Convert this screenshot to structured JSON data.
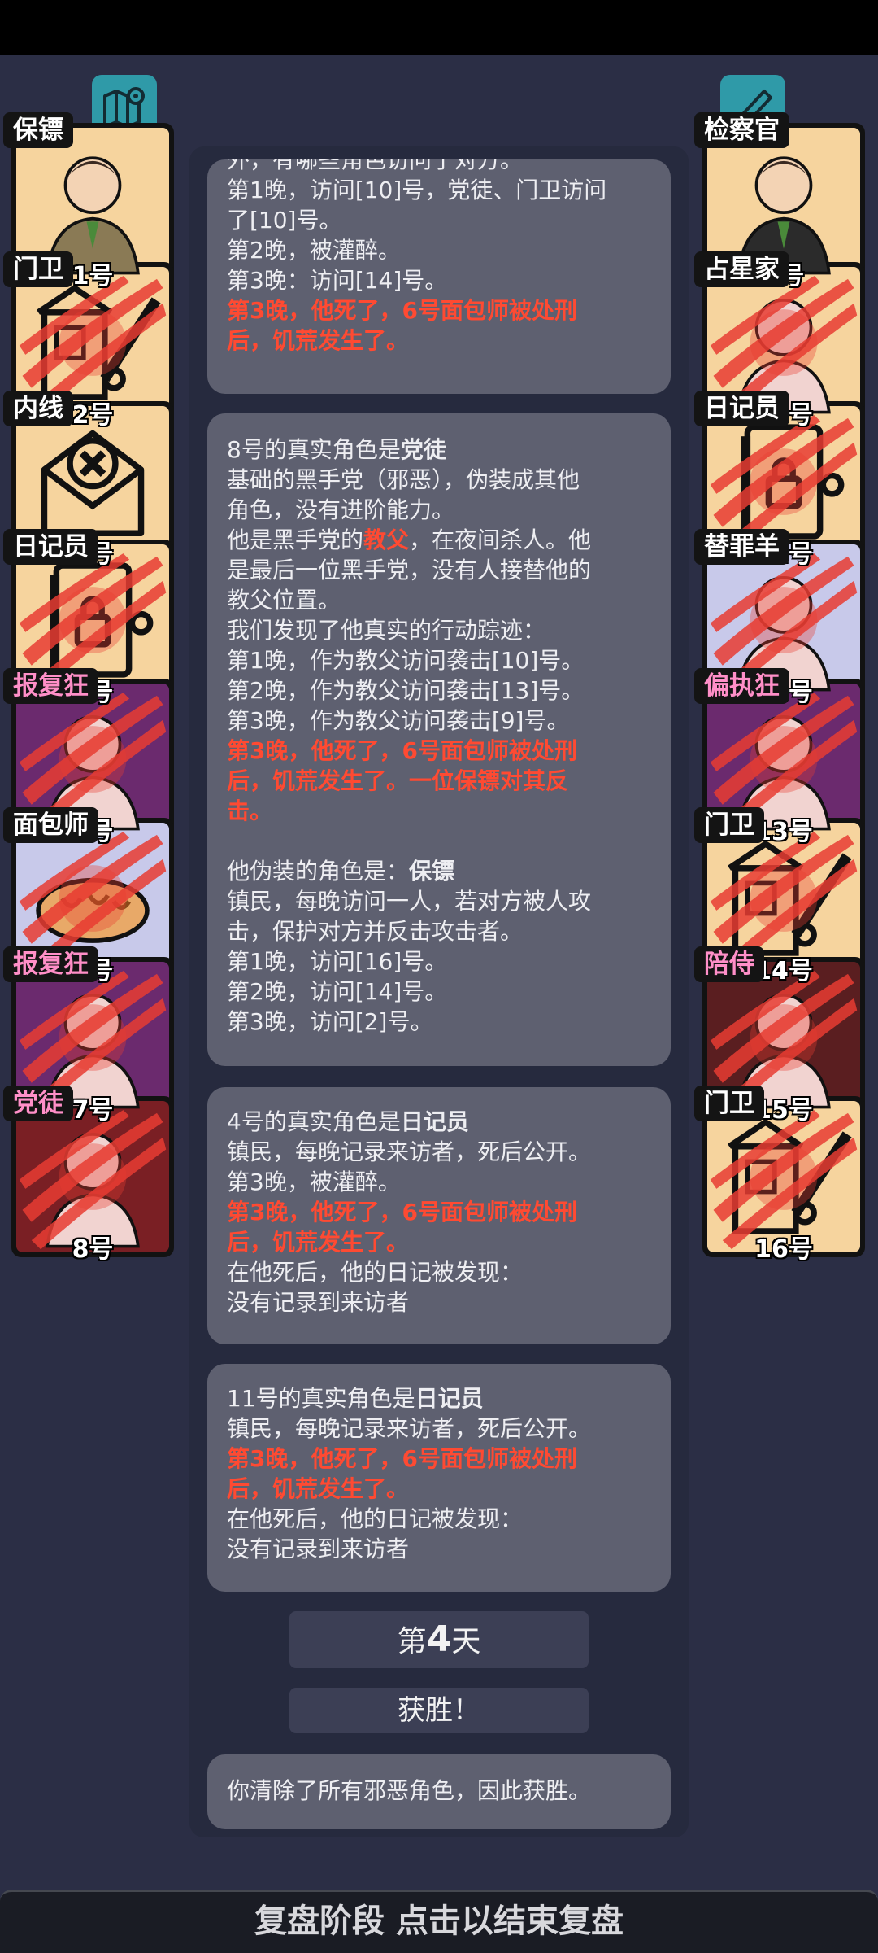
{
  "top": {
    "map_icon": "map-pin-icon",
    "notes_icon": "pen-signature-icon"
  },
  "players_left": [
    {
      "role": "保镖",
      "number": "1号",
      "bg": "#f6d49e",
      "dead": false,
      "label_color": "white"
    },
    {
      "role": "门卫",
      "number": "2号",
      "bg": "#f6d49e",
      "dead": true,
      "label_color": "white"
    },
    {
      "role": "内线",
      "number": "3号",
      "bg": "#f6d49e",
      "dead": false,
      "label_color": "white"
    },
    {
      "role": "日记员",
      "number": "4号",
      "bg": "#f6d49e",
      "dead": true,
      "label_color": "white"
    },
    {
      "role": "报复狂",
      "number": "5号",
      "bg": "#6b2a6e",
      "dead": true,
      "label_color": "pink"
    },
    {
      "role": "面包师",
      "number": "6号",
      "bg": "#c8c9ea",
      "dead": true,
      "label_color": "white"
    },
    {
      "role": "报复狂",
      "number": "7号",
      "bg": "#6b2a6e",
      "dead": true,
      "label_color": "pink"
    },
    {
      "role": "党徒",
      "number": "8号",
      "bg": "#7a1f24",
      "dead": true,
      "label_color": "pink"
    }
  ],
  "players_right": [
    {
      "role": "检察官",
      "number": "9号",
      "bg": "#f6d49e",
      "dead": false,
      "label_color": "white"
    },
    {
      "role": "占星家",
      "number": "10号",
      "bg": "#f6d49e",
      "dead": true,
      "label_color": "white"
    },
    {
      "role": "日记员",
      "number": "11号",
      "bg": "#f6d49e",
      "dead": true,
      "label_color": "white"
    },
    {
      "role": "替罪羊",
      "number": "12号",
      "bg": "#c8c9ea",
      "dead": true,
      "label_color": "white"
    },
    {
      "role": "偏执狂",
      "number": "13号",
      "bg": "#6b2a6e",
      "dead": true,
      "label_color": "pink"
    },
    {
      "role": "门卫",
      "number": "14号",
      "bg": "#f6d49e",
      "dead": true,
      "label_color": "white"
    },
    {
      "role": "陪侍",
      "number": "15号",
      "bg": "#5a1e20",
      "dead": true,
      "label_color": "pink"
    },
    {
      "role": "门卫",
      "number": "16号",
      "bg": "#f6d49e",
      "dead": true,
      "label_color": "white"
    }
  ],
  "cards": {
    "card1": {
      "l0": "外，有哪些角色访问了对方。",
      "l1": "第1晚，访问[10]号，党徒、门卫访问",
      "l2": "了[10]号。",
      "l3": "第2晚，被灌醉。",
      "l4": "第3晚：访问[14]号。",
      "l5": "第3晚，他死了，6号面包师被处刑",
      "l6": "后，饥荒发生了。"
    },
    "card2": {
      "t_prefix": "8号的真实角色是",
      "t_role": "党徒",
      "l1": "基础的黑手党（邪恶），伪装成其他",
      "l2": "角色，没有进阶能力。",
      "l3a": "他是黑手党的",
      "l3b": "教父",
      "l3c": "，在夜间杀人。他",
      "l4": "是最后一位黑手党，没有人接替他的",
      "l5": "教父位置。",
      "l6": "我们发现了他真实的行动踪迹：",
      "l7": "第1晚，作为教父访问袭击[10]号。",
      "l8": "第2晚，作为教父访问袭击[13]号。",
      "l9": "第3晚，作为教父访问袭击[9]号。",
      "l10": "第3晚，他死了，6号面包师被处刑",
      "l11": "后，饥荒发生了。一位保镖对其反",
      "l12": "击。",
      "l13a": "他伪装的角色是：",
      "l13b": "保镖",
      "l14": "镇民，每晚访问一人，若对方被人攻",
      "l15": "击，保护对方并反击攻击者。",
      "l16": "第1晚，访问[16]号。",
      "l17": "第2晚，访问[14]号。",
      "l18": "第3晚，访问[2]号。"
    },
    "card3": {
      "t_prefix": "4号的真实角色是",
      "t_role": "日记员",
      "l1": "镇民，每晚记录来访者，死后公开。",
      "l2": "第3晚，被灌醉。",
      "l3": "第3晚，他死了，6号面包师被处刑",
      "l4": "后，饥荒发生了。",
      "l5": "在他死后，他的日记被发现：",
      "l6": "没有记录到来访者"
    },
    "card4": {
      "t_prefix": "11号的真实角色是",
      "t_role": "日记员",
      "l1": "镇民，每晚记录来访者，死后公开。",
      "l2": "第3晚，他死了，6号面包师被处刑",
      "l3": "后，饥荒发生了。",
      "l4": "在他死后，他的日记被发现：",
      "l5": "没有记录到来访者"
    }
  },
  "day": {
    "prefix": "第",
    "number": "4",
    "suffix": "天"
  },
  "victory": "获胜！",
  "victory_message": "你清除了所有邪恶角色，因此获胜。",
  "bottom_bar": "复盘阶段 点击以结束复盘",
  "colors": {
    "highlight_red": "#ff4a32",
    "card_bg": "#5e6070",
    "page_bg": "#2b2e45",
    "accent_teal": "#2f9aa8"
  }
}
